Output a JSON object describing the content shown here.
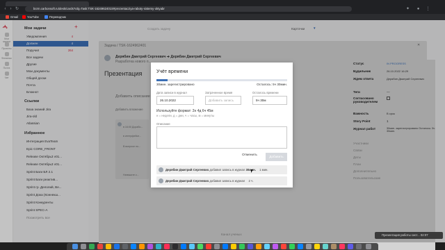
{
  "browser": {
    "url": "bcrm.carbonsoft.ru/desk/cards?obj=Task:TSK-1624962401S#prezentacziya-raboty-sistemy-oktyabr",
    "bookmarks": [
      {
        "label": "Gmail",
        "icon": "gmail-icon",
        "color": "#ea4335"
      },
      {
        "label": "YouTube",
        "icon": "youtube-icon",
        "color": "#ff0000"
      },
      {
        "label": "Переводчик",
        "icon": "translate-icon",
        "color": "#4285f4"
      }
    ]
  },
  "rail": {
    "items": [
      {
        "label": "Мои задачи",
        "icon": "tasks-icon"
      },
      {
        "label": "Проекты",
        "icon": "projects-icon"
      },
      {
        "label": "Финансы",
        "icon": "finance-icon"
      },
      {
        "label": "Почта",
        "icon": "mail-icon"
      },
      {
        "label": "Чат",
        "icon": "chat-icon"
      }
    ]
  },
  "sidebar": {
    "my_tasks_title": "Мои задачи",
    "items": [
      {
        "label": "Уведомления",
        "count": "4"
      },
      {
        "label": "Должен",
        "count": "4"
      },
      {
        "label": "Поручил",
        "count": "264"
      },
      {
        "label": "Все задачи",
        "count": ""
      },
      {
        "label": "Другие",
        "count": ""
      },
      {
        "label": "Мои документы",
        "count": ""
      },
      {
        "label": "Общей доски",
        "count": ""
      },
      {
        "label": "Почта",
        "count": ""
      },
      {
        "label": "Блокнот",
        "count": ""
      }
    ],
    "links_title": "Ссылки",
    "links": [
      "База знаний Jira",
      "Jira-old",
      "Atlassian"
    ],
    "favorites_title": "Избранное",
    "favorites": [
      "Интеграция EvaTeam",
      "Epic CORE_FRONT",
      "Release Октябрь3 v01...",
      "Release Октябрь3 v01...",
      "Sprint Баги БЛ 2.1",
      "Sprint Баги реактив...",
      "Sprint гр. Делолий, Ве...",
      "Sprint Дока (Коннекш...",
      "Sprint Конкуренты",
      "Sprint SPEC-A"
    ],
    "show_all": "Посмотреть все"
  },
  "topbar": {
    "create_placeholder": "Создать задачу",
    "cards_label": "Карточки"
  },
  "card": {
    "breadcrumb": "Задача  /  TSK-1624962401",
    "author_line": "Дерябин Дмитрий Сергеевич  ➔  Дерябин Дмитрий Сергеевич",
    "sub_line": "Разработка нового п...",
    "title": "Презентация",
    "add_desc": "Добавить описание",
    "add_attach": "Добавить вложение",
    "comment_author": "Дерябин Дмитрий Сергеевич",
    "comment_1": "в 16:00 Дорабо...",
    "comment_2": "в интерфейсе...",
    "comment_3": "В вопросе по...",
    "write_comment": "Напишите к..."
  },
  "right_panel": {
    "rows": [
      {
        "label": "Статус",
        "value": "IN PROGRESS"
      },
      {
        "label": "Будильник",
        "value": "26.10.2022 16:29"
      },
      {
        "label": "Ждем ответа",
        "value": "Дерябин Дмитрий Сергеевич"
      },
      {
        "label": "Теги",
        "value": "—"
      },
      {
        "label": "Согласовано руководителем",
        "value": ""
      },
      {
        "label": "Важность",
        "value": "В срок"
      },
      {
        "label": "Story Point",
        "value": "1"
      },
      {
        "label": "Журнал работ",
        "value": "30мин. зарегистрировано Осталось: 5ч 30мин."
      }
    ],
    "links": [
      "Участники",
      "Связи",
      "Даты",
      "План",
      "Дополнительно",
      "Пользовательские"
    ]
  },
  "modal": {
    "title": "Учёт времени",
    "progress_fraction": 0.083,
    "logged_text": "30мин. зарегистрировано",
    "remaining_text": "Осталось: 5ч 30мин.",
    "date_label": "Дата записи в журнал",
    "date_value": "26.10.2022",
    "spent_label": "Затраченное время",
    "spent_placeholder": "Добавить запись",
    "remain_label": "Осталось времени",
    "remain_value": "5ч 30м",
    "format_hint": "Используйте формат: 2н 4д 6ч 45м",
    "format_legend": "н = недели, д = дни, ч = часы, м = минуты",
    "desc_label": "Описание",
    "cancel_label": "Отменить",
    "add_label": "Добавить",
    "log_entries": [
      {
        "author": "Дерябин Дмитрий Сергеевич",
        "action": "добавил запись в журнал",
        "amount": "30мин.",
        "extra": "1 мин."
      },
      {
        "author": "Дерябин Дмитрий Сергеевич",
        "action": "добавил запись в журнал",
        "amount": "2 ч.",
        "extra": ""
      }
    ]
  },
  "footer": {
    "sub": "Канал ученых"
  },
  "notification": {
    "text": "Презентация работы сист... 02:07"
  }
}
